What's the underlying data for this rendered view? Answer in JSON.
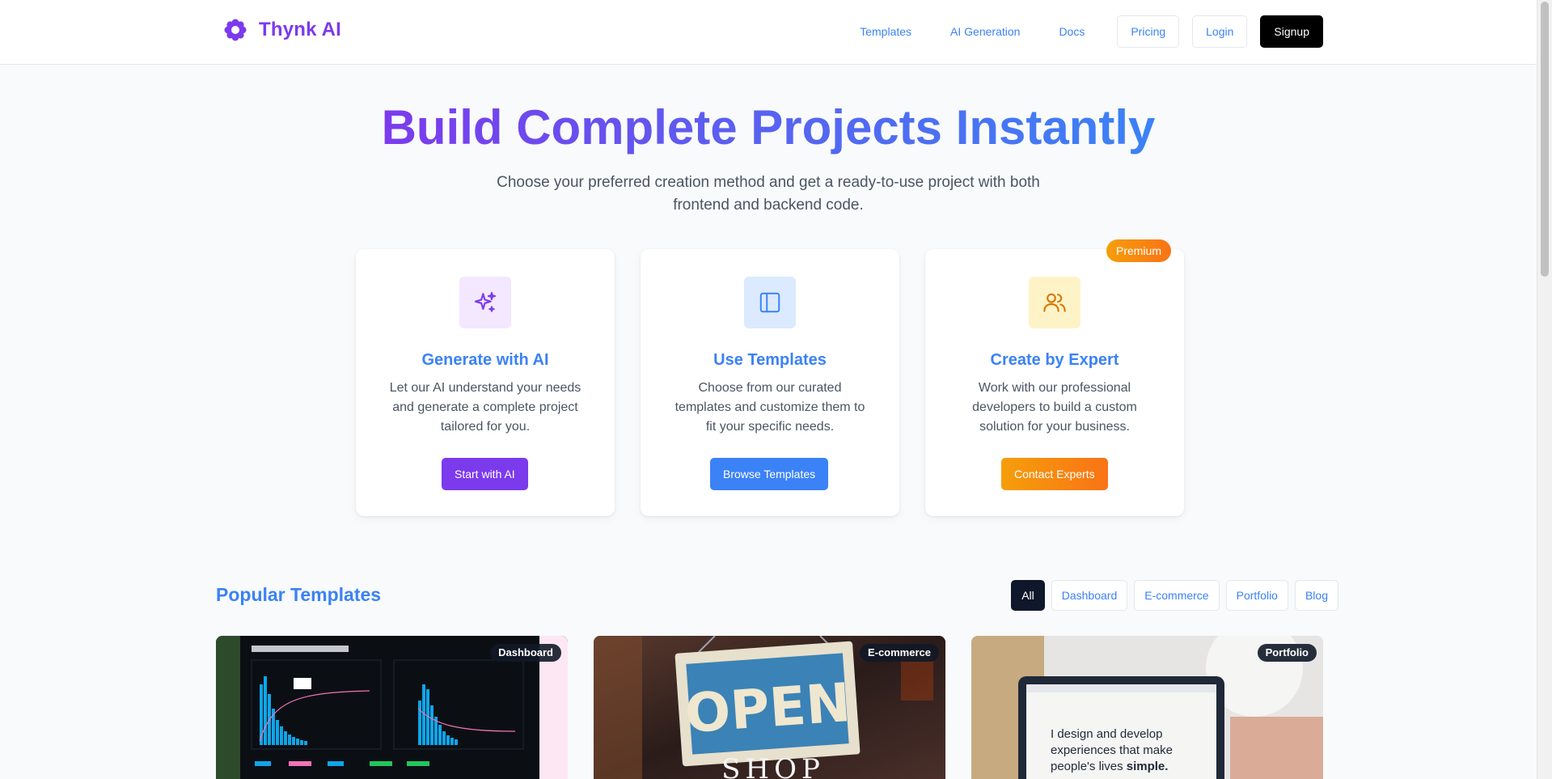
{
  "brand": {
    "name": "Thynk AI"
  },
  "nav": {
    "templates": "Templates",
    "ai_generation": "AI Generation",
    "docs": "Docs",
    "pricing": "Pricing",
    "login": "Login",
    "signup": "Signup"
  },
  "hero": {
    "title": "Build Complete Projects Instantly",
    "subtitle": "Choose your preferred creation method and get a ready-to-use project with both frontend and backend code."
  },
  "cards": [
    {
      "title": "Generate with AI",
      "description": "Let our AI understand your needs and generate a complete project tailored for you.",
      "button": "Start with AI",
      "icon": "sparkles-icon",
      "accent": "#7c3aed"
    },
    {
      "title": "Use Templates",
      "description": "Choose from our curated templates and customize them to fit your specific needs.",
      "button": "Browse Templates",
      "icon": "layout-icon",
      "accent": "#3b82f6"
    },
    {
      "title": "Create by Expert",
      "description": "Work with our professional developers to build a custom solution for your business.",
      "button": "Contact Experts",
      "icon": "users-icon",
      "accent": "#f59e0b",
      "badge": "Premium"
    }
  ],
  "popular": {
    "title": "Popular Templates",
    "filters": [
      "All",
      "Dashboard",
      "E-commerce",
      "Portfolio",
      "Blog"
    ],
    "active_filter": "All",
    "templates": [
      {
        "category": "Dashboard"
      },
      {
        "category": "E-commerce",
        "image_text": "OPEN"
      },
      {
        "category": "Portfolio",
        "image_text": "I design and develop experiences that make people's lives simple."
      }
    ]
  },
  "colors": {
    "brand_purple": "#7c3aed",
    "brand_blue": "#3b82f6",
    "premium_orange": "#f59e0b"
  }
}
